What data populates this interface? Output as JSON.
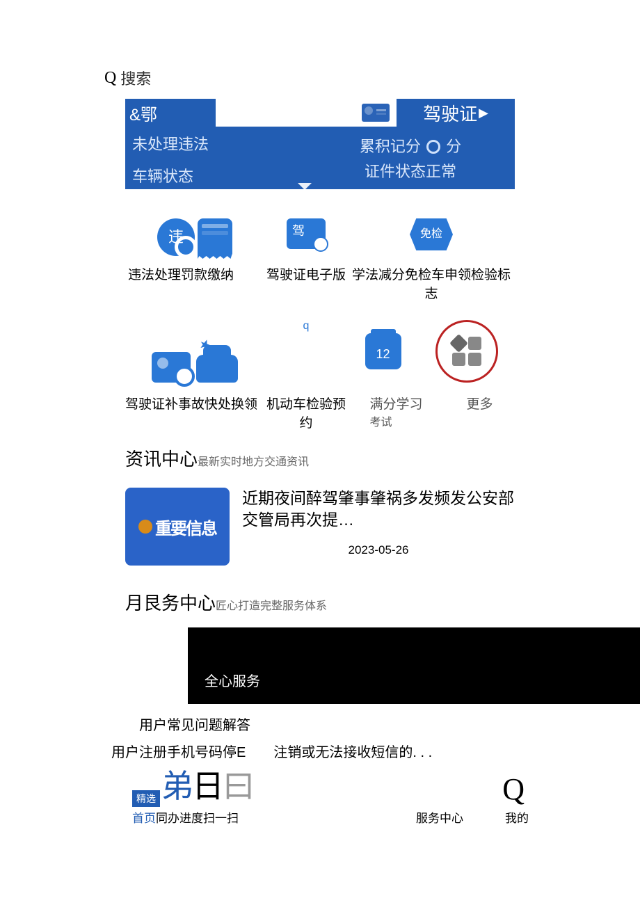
{
  "search": {
    "placeholder": "搜索"
  },
  "header": {
    "plate_prefix": "&鄂",
    "license_btn": "驾驶证",
    "left_row1": "未处理违法",
    "left_row2": "车辆状态",
    "right_row1_a": "累积记分",
    "right_row1_b": "分",
    "right_row2": "证件状态正常"
  },
  "grid": {
    "r1": {
      "wei": "违",
      "jia": "驾",
      "mian": "免检",
      "lab_left": "违法处理罚款缴纳",
      "lab_mid": "驾驶证电子版",
      "lab_right": "学法减分免检车申领检验标志"
    },
    "r2": {
      "q": "q",
      "cal": "12",
      "lab_left": "驾驶证补事故快处换领",
      "lab_mid": "机动车检验预约",
      "lab_full": "满分学习",
      "lab_full2": "考试",
      "lab_more": "更多"
    }
  },
  "news_section": {
    "title": "资讯中心",
    "sub": "最新实时地方交通资讯"
  },
  "news": {
    "thumb_text": "重要信息",
    "title": "近期夜间醉驾肇事肇祸多发频发公安部交管局再次提…",
    "date": "2023-05-26"
  },
  "service_section": {
    "title": "月艮务中心",
    "sub": "匠心打造完整服务体系"
  },
  "service_banner": "全心服务",
  "faq": {
    "title": "用户常见问题解答",
    "left": "用户注册手机号码停E",
    "right": "注销或无法接收短信的. . ."
  },
  "nav": {
    "tag": "精选",
    "glyph1": "弟",
    "glyph2": "日",
    "glyph3": "曰",
    "home": "首页",
    "progress": "同办进度",
    "scan": "扫一扫",
    "service": "服务中心",
    "mine": "我的"
  }
}
